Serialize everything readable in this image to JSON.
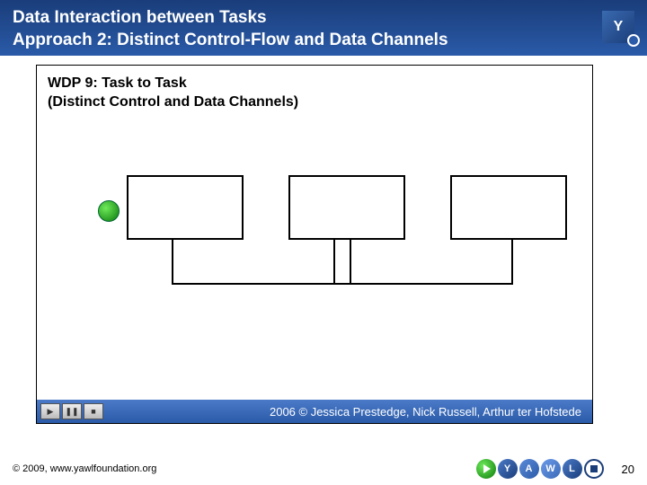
{
  "header": {
    "title_line1": "Data Interaction between Tasks",
    "title_line2": "Approach 2: Distinct Control-Flow and Data Channels",
    "logo_letter": "Y"
  },
  "panel": {
    "title_line1": "WDP 9: Task to Task",
    "title_line2": "(Distinct Control and Data Channels)",
    "credits": "2006 © Jessica Prestedge, Nick Russell, Arthur ter Hofstede"
  },
  "controls": {
    "play": "▶",
    "pause": "❚❚",
    "stop": "■"
  },
  "footer": {
    "copyright": "© 2009, www.yawlfoundation.org",
    "logo_letters": [
      "Y",
      "A",
      "W",
      "L"
    ],
    "page": "20"
  }
}
